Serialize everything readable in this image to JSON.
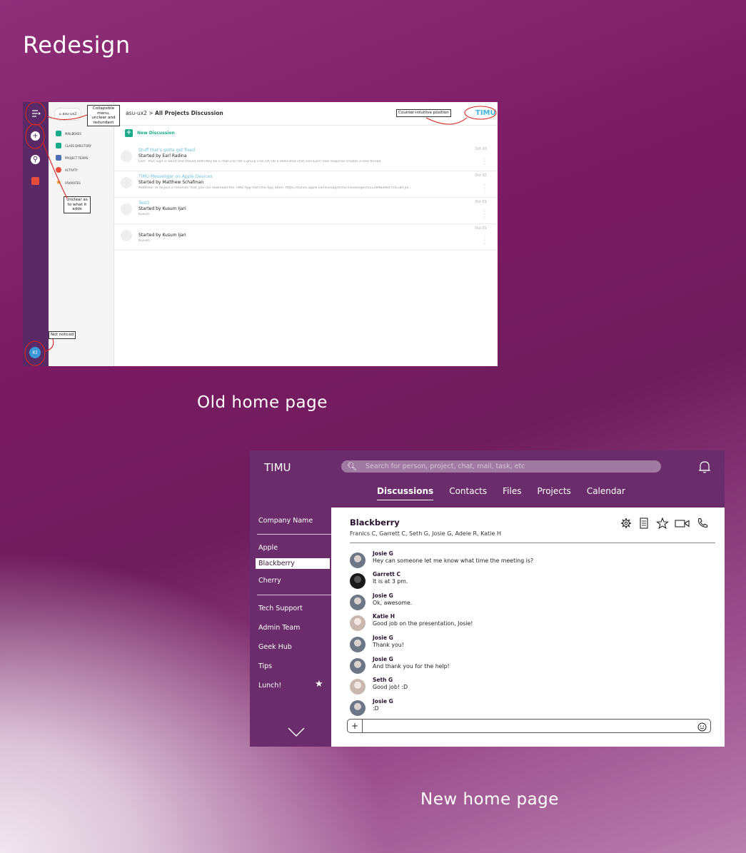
{
  "page": {
    "title": "Redesign",
    "old_caption": "Old home page",
    "new_caption": "New home page"
  },
  "old_ui": {
    "rail_avatar": "KI",
    "home_chip": "asu-ux2",
    "breadcrumb_parent": "asu-ux2",
    "breadcrumb_sep": ">",
    "breadcrumb_current": "All Projects Discussion",
    "brand": "TIMU",
    "new_discussion": "New Discussion",
    "menu": [
      {
        "label": "MAILBOXES",
        "color": "#1aab8a"
      },
      {
        "label": "CLASS DIRECTORY",
        "color": "#1aab8a"
      },
      {
        "label": "PROJECT TEAMS",
        "color": "#4a6fb5"
      },
      {
        "label": "ACTIVITY",
        "color": "#e74c3c"
      },
      {
        "label": "FAVORITES",
        "color": "#f39c12"
      }
    ],
    "threads": [
      {
        "title": "Stuff that's gotta get fixed",
        "starter": "Started by Earl Radina",
        "preview": "Earl: -Plus Sign is weird and should definitely be a chat icon OR a group icon OR OR a dedicated chat icon-Each new response creates a new thread",
        "date": "Oct 03"
      },
      {
        "title": "TIMU Messenger on Apple Devices",
        "starter": "Started by Matthew Schafman",
        "preview": "Matthew: Hi All,Just a reminder that you can download the TIMU App from the App Store. https://itunes.apple.com/us/app/timu-messenger/id1128983984?mt=8if yo...",
        "date": "Oct 02"
      },
      {
        "title": "Test1",
        "starter": "Started by Kusum Ijari",
        "preview": "Kusum:",
        "date": "Oct 01"
      },
      {
        "title": "",
        "starter": "Started by Kusum Ijari",
        "preview": "Kusum:",
        "date": "Oct 01"
      }
    ],
    "annotations": {
      "collapsible": "Collapsible menu, unclear and redundant",
      "counter": "Counter-intuitive position",
      "unclear": "Unclear as to what it adds",
      "not_noticed": "Not noticed"
    }
  },
  "new_ui": {
    "brand": "TIMU",
    "search_placeholder": "Search for person, project, chat, mail, task, etc",
    "tabs": [
      {
        "label": "Discussions",
        "active": true
      },
      {
        "label": "Contacts",
        "active": false
      },
      {
        "label": "Files",
        "active": false
      },
      {
        "label": "Projects",
        "active": false
      },
      {
        "label": "Calendar",
        "active": false
      }
    ],
    "sidebar": {
      "company": "Company Name",
      "channels": [
        "Apple",
        "Blackberry",
        "Cherry"
      ],
      "selected": "Blackberry",
      "groups": [
        "Tech Support",
        "Admin Team",
        "Geek Hub",
        "Tips",
        "Lunch!"
      ]
    },
    "chat": {
      "room": "Blackberry",
      "members": "Franics C, Garrett C, Seth G,  Josie G, Adele R, Katie H",
      "messages": [
        {
          "name": "Josie G",
          "text": "Hey can someone let me know what time the meeting is?"
        },
        {
          "name": "Garrett C",
          "text": "It is at 3 pm."
        },
        {
          "name": "Josie G",
          "text": "Ok, awesome."
        },
        {
          "name": "Katie H",
          "text": "Good job on the presentation, Josie!"
        },
        {
          "name": "Josie G",
          "text": "Thank you!"
        },
        {
          "name": "Josie G",
          "text": "And thank you for the help!"
        },
        {
          "name": "Seth G",
          "text": "Good job! :D"
        },
        {
          "name": "Josie G",
          "text": ":D"
        }
      ],
      "composer_plus": "+"
    }
  },
  "colors": {
    "old_rail": "#5a2a66",
    "new_chrome": "#6a2c6a",
    "annotation_red": "#d8261f",
    "timu_blue": "#3fb6d8"
  }
}
